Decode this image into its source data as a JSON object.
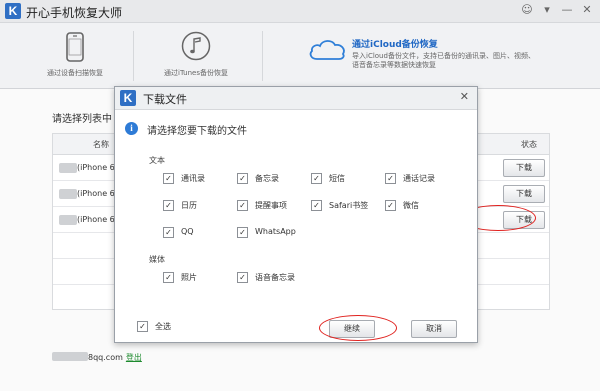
{
  "app": {
    "logo_letter": "K",
    "title": "开心手机恢复大师"
  },
  "window_controls": [
    "☺",
    "▾",
    "—",
    "✕"
  ],
  "modes": [
    {
      "label": "通过设备扫描恢复",
      "icon": "phone-icon"
    },
    {
      "label": "通过iTunes备份恢复",
      "icon": "music-note-icon"
    },
    {
      "label": "通过iCloud备份恢复",
      "icon": "cloud-icon",
      "active": true,
      "desc_line1": "导入iCloud备份文件，支持已备份的通讯录、图片、视频、",
      "desc_line2": "语音备忘录等数据快速恢复"
    }
  ],
  "main": {
    "instruction": "请选择列表中",
    "table": {
      "col_name": "名称",
      "col_status": "状态",
      "rows": [
        {
          "device": "(iPhone 6)",
          "action": "下载"
        },
        {
          "device": "(iPhone 6)",
          "action": "下载"
        },
        {
          "device": "(iPhone 6)",
          "action": "下载"
        }
      ]
    },
    "account_suffix": "8qq.com",
    "logout_label": "登出"
  },
  "dialog": {
    "logo_letter": "K",
    "title": "下载文件",
    "close": "✕",
    "prompt": "请选择您要下载的文件",
    "section_text": "文本",
    "text_options": [
      "通讯录",
      "备忘录",
      "短信",
      "通话记录",
      "日历",
      "提醒事项",
      "Safari书签",
      "微信",
      "QQ",
      "WhatsApp"
    ],
    "section_media": "媒体",
    "media_options": [
      "照片",
      "语音备忘录"
    ],
    "select_all": "全选",
    "continue_label": "继续",
    "cancel_label": "取消",
    "checkmark": "✓"
  },
  "colors": {
    "accent": "#1f67c4",
    "annotation_red": "#e0221f",
    "logout_green": "#1d8a2e"
  }
}
